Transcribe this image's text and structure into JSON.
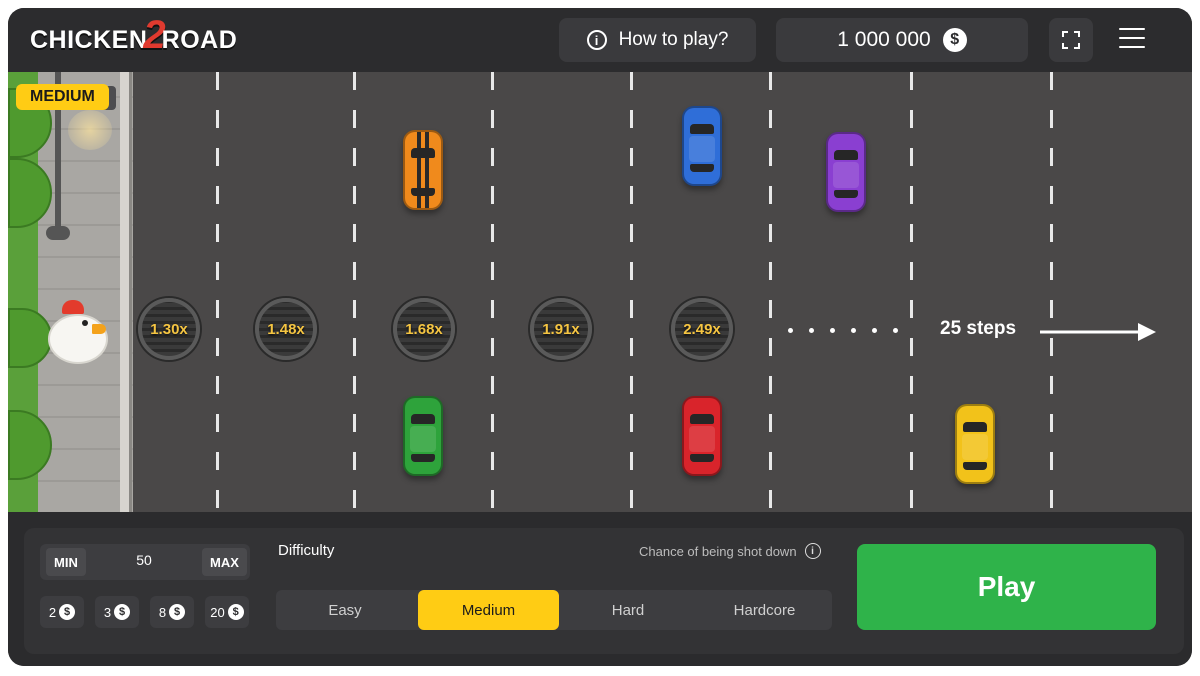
{
  "header": {
    "logo_left": "CHICKEN",
    "logo_num": "2",
    "logo_right": "ROAD",
    "how_to_play": "How to play?",
    "balance": "1 000 000",
    "currency_symbol": "$"
  },
  "game": {
    "difficulty_badge": "MEDIUM",
    "multipliers": [
      "1.30x",
      "1.48x",
      "1.68x",
      "1.91x",
      "2.49x"
    ],
    "steps_label": "25 steps"
  },
  "bet": {
    "min_label": "MIN",
    "max_label": "MAX",
    "value": "50",
    "quick_amounts": [
      "2",
      "3",
      "8",
      "20"
    ]
  },
  "difficulty": {
    "label": "Difficulty",
    "chance_label": "Chance of being shot down",
    "options": [
      "Easy",
      "Medium",
      "Hard",
      "Hardcore"
    ],
    "selected": "Medium"
  },
  "play_label": "Play",
  "colors": {
    "accent_yellow": "#ffcc14",
    "play_green": "#2fb34a",
    "multiplier_text": "#f5c542",
    "road": "#4a4848"
  },
  "icons": [
    "info-icon",
    "dollar-coin-icon",
    "fullscreen-icon",
    "hamburger-menu-icon",
    "arrow-right-icon"
  ]
}
